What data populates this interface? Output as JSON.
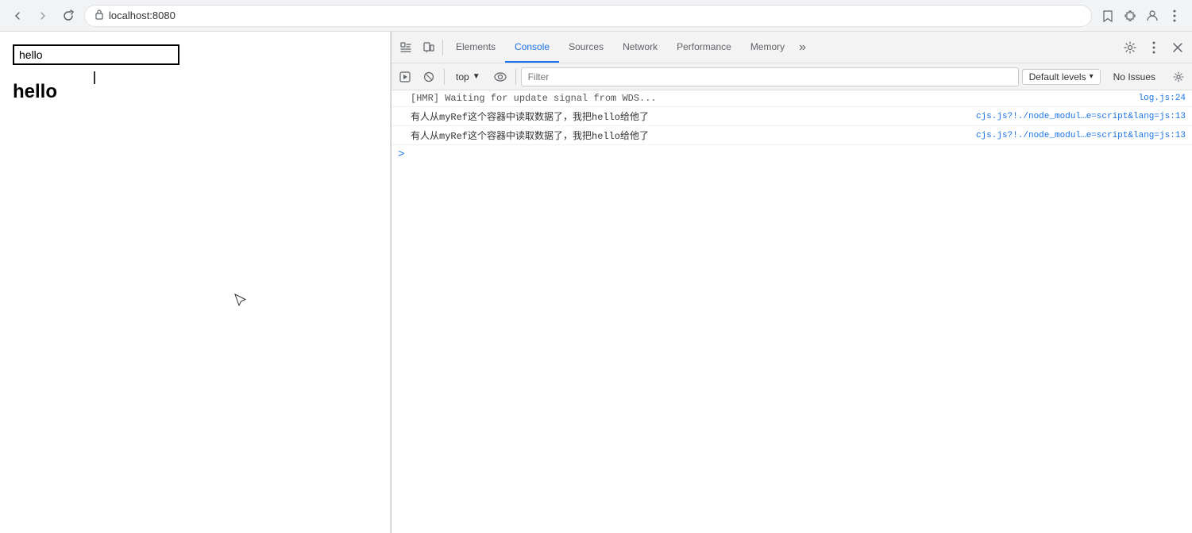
{
  "browser": {
    "back_button": "←",
    "forward_button": "→",
    "refresh_button": "↻",
    "url": "localhost:8080",
    "bookmark_icon": "☆",
    "extensions_icon": "🧩",
    "profile_icon": "👤",
    "more_icon": "⋮"
  },
  "page": {
    "input_value": "hello",
    "input_placeholder": "",
    "hello_label": "hello"
  },
  "devtools": {
    "tabs": [
      {
        "id": "elements",
        "label": "Elements",
        "active": false
      },
      {
        "id": "console",
        "label": "Console",
        "active": true
      },
      {
        "id": "sources",
        "label": "Sources",
        "active": false
      },
      {
        "id": "network",
        "label": "Network",
        "active": false
      },
      {
        "id": "performance",
        "label": "Performance",
        "active": false
      },
      {
        "id": "memory",
        "label": "Memory",
        "active": false
      }
    ],
    "overflow_label": "»",
    "settings_icon": "⚙",
    "more_icon": "⋮",
    "close_icon": "✕",
    "toolbar": {
      "execute_icon": "▶",
      "block_icon": "⊘",
      "top_label": "top",
      "eye_icon": "👁",
      "filter_placeholder": "Filter",
      "default_levels_label": "Default levels",
      "no_issues_label": "No Issues",
      "settings_icon": "⚙"
    },
    "console_rows": [
      {
        "id": "hmr",
        "text": "[HMR] Waiting for update signal from WDS...",
        "link": "log.js:24",
        "icon": ""
      },
      {
        "id": "log1",
        "text": "有人从myRef这个容器中读取数据了，我把hello给他了",
        "link": "cjs.js?!./node_modul…e=script&lang=js:13",
        "icon": ""
      },
      {
        "id": "log2",
        "text": "有人从myRef这个容器中读取数据了，我把hello给他了",
        "link": "cjs.js?!./node_modul…e=script&lang=js:13",
        "icon": ""
      }
    ],
    "prompt_arrow": ">"
  }
}
